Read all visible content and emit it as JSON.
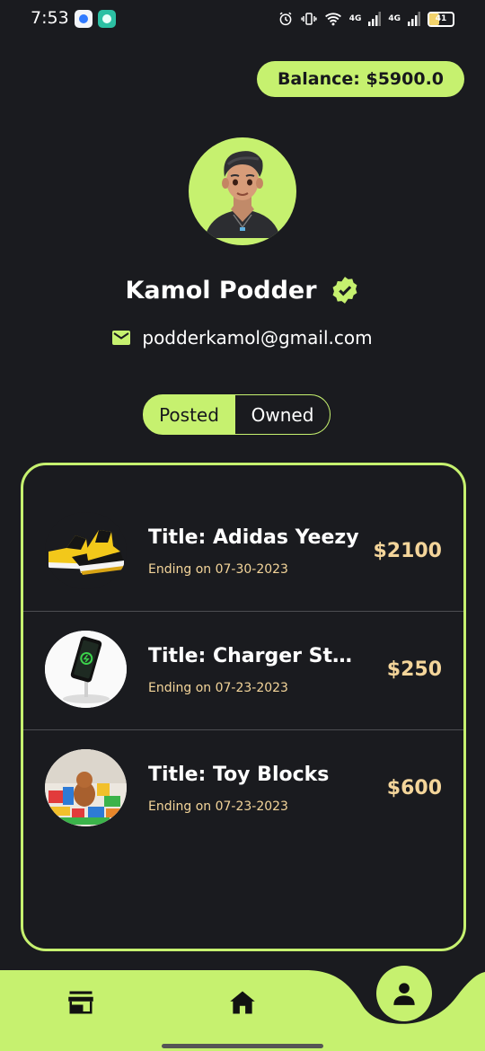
{
  "status_bar": {
    "time": "7:53",
    "network_1": "4G",
    "network_2": "4G",
    "battery": "41"
  },
  "profile": {
    "balance_label": "Balance: $5900.0",
    "name": "Kamol Podder",
    "email": "podderkamol@gmail.com",
    "verified_icon": "verified-badge-icon",
    "email_icon": "mail-icon"
  },
  "tabs": {
    "posted": "Posted",
    "owned": "Owned",
    "active": "posted"
  },
  "items": [
    {
      "title": "Title: Adidas Yeezy",
      "ending": "Ending on 07-30-2023",
      "price": "$2100"
    },
    {
      "title": "Title: Charger Sta...",
      "ending": "Ending on 07-23-2023",
      "price": "$250"
    },
    {
      "title": "Title: Toy Blocks",
      "ending": "Ending on 07-23-2023",
      "price": "$600"
    }
  ],
  "nav": {
    "items": [
      "store-icon",
      "home-icon",
      "person-icon"
    ],
    "active": "profile"
  },
  "colors": {
    "accent": "#c6f16f",
    "background": "#1a1b1f",
    "price": "#f4d59a"
  }
}
